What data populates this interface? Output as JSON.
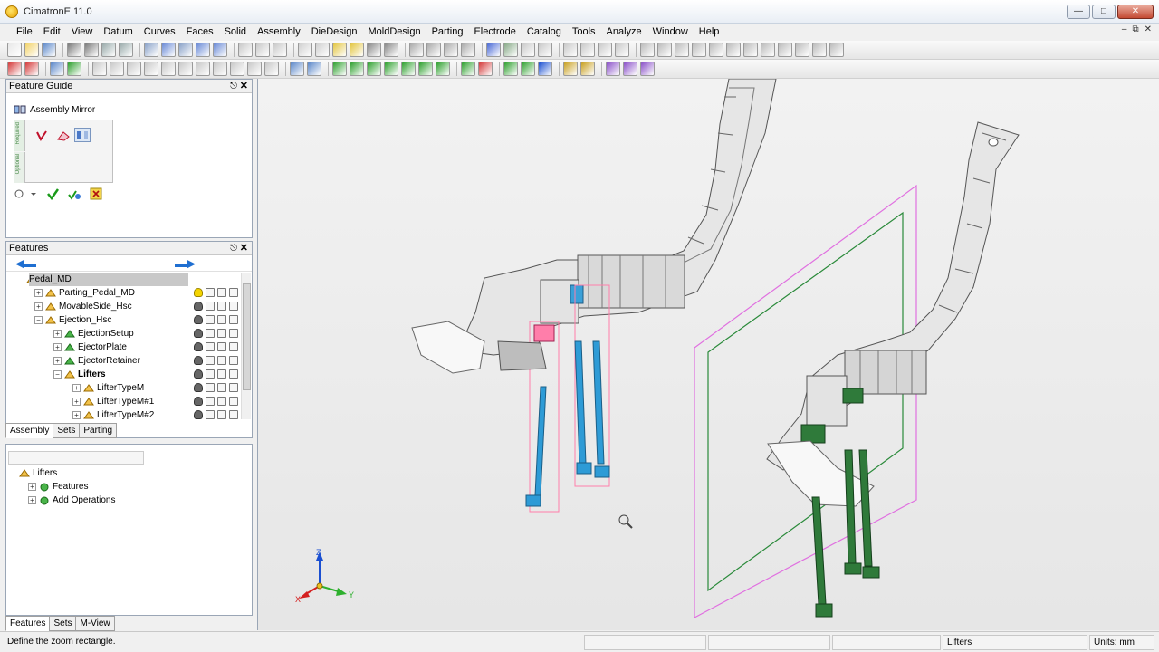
{
  "window": {
    "title": "CimatronE 11.0"
  },
  "menu": [
    "File",
    "Edit",
    "View",
    "Datum",
    "Curves",
    "Faces",
    "Solid",
    "Assembly",
    "DieDesign",
    "MoldDesign",
    "Parting",
    "Electrode",
    "Catalog",
    "Tools",
    "Analyze",
    "Window",
    "Help"
  ],
  "feature_guide": {
    "header": "Feature Guide",
    "title": "Assembly Mirror",
    "required_label": "Required",
    "optional_label": "Optional"
  },
  "features_panel": {
    "header": "Features",
    "tree": [
      {
        "label": "Pedal_MD",
        "level": 0,
        "expander": "",
        "selected": true,
        "bold": false
      },
      {
        "label": "Parting_Pedal_MD",
        "level": 1,
        "expander": "+",
        "selected": false,
        "bold": false
      },
      {
        "label": "MovableSide_Hsc",
        "level": 1,
        "expander": "+",
        "selected": false,
        "bold": false
      },
      {
        "label": "Ejection_Hsc",
        "level": 1,
        "expander": "-",
        "selected": false,
        "bold": false
      },
      {
        "label": "EjectionSetup",
        "level": 2,
        "expander": "+",
        "selected": false,
        "bold": false
      },
      {
        "label": "EjectorPlate",
        "level": 2,
        "expander": "+",
        "selected": false,
        "bold": false
      },
      {
        "label": "EjectorRetainer",
        "level": 2,
        "expander": "+",
        "selected": false,
        "bold": false
      },
      {
        "label": "Lifters",
        "level": 2,
        "expander": "-",
        "selected": false,
        "bold": true
      },
      {
        "label": "LifterTypeM",
        "level": 3,
        "expander": "+",
        "selected": false,
        "bold": false
      },
      {
        "label": "LifterTypeM#1",
        "level": 3,
        "expander": "+",
        "selected": false,
        "bold": false
      },
      {
        "label": "LifterTypeM#2",
        "level": 3,
        "expander": "+",
        "selected": false,
        "bold": false
      }
    ],
    "tabs": [
      "Assembly",
      "Sets",
      "Parting"
    ]
  },
  "ops_panel": {
    "tree": [
      {
        "label": "Lifters",
        "level": 0,
        "expander": ""
      },
      {
        "label": "Features",
        "level": 1,
        "expander": "+"
      },
      {
        "label": "Add Operations",
        "level": 1,
        "expander": "+"
      }
    ],
    "tabs": [
      "Features",
      "Sets",
      "M-View"
    ]
  },
  "axes": {
    "x": "X",
    "y": "Y",
    "z": "Z"
  },
  "status": {
    "message": "Define the zoom rectangle.",
    "context": "Lifters",
    "units": "Units: mm"
  },
  "colors": {
    "lifter_blue": "#2e9bd6",
    "lifter_green": "#2f7a3a",
    "plane_magenta": "#e070e0",
    "plane_green": "#2a8a3a",
    "highlight_pink": "#ff6aa0",
    "part_gray": "#dcdcdc"
  }
}
